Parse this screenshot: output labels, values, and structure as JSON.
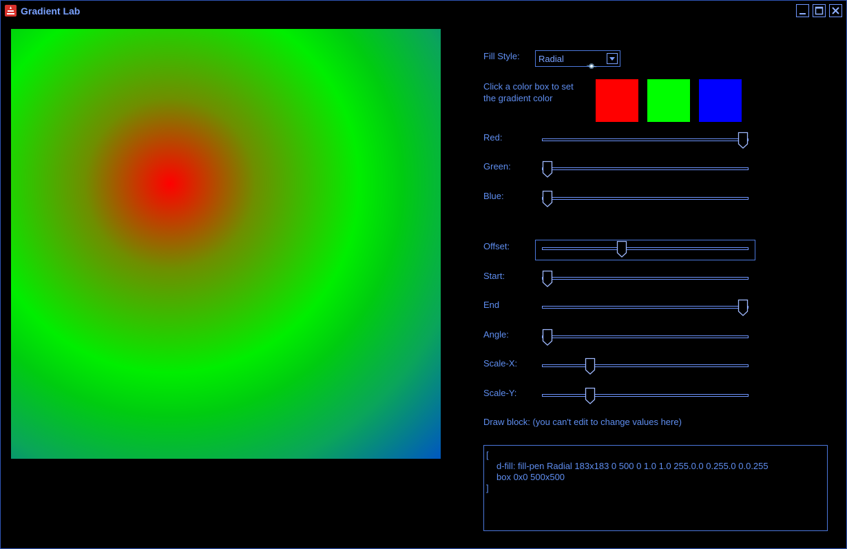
{
  "window": {
    "title": "Gradient Lab",
    "controls": {
      "minimize": "minimize-icon",
      "maximize": "maximize-icon",
      "close": "close-icon"
    }
  },
  "preview": {
    "fill_type": "radial",
    "colors": [
      "#ff0000",
      "#00ff00",
      "#0000ff"
    ]
  },
  "panel": {
    "fill_style_label": "Fill Style:",
    "fill_style_value": "Radial",
    "hint_line1": "Click a color box to set",
    "hint_line2": "the gradient color",
    "swatches": [
      {
        "color": "#ff0000"
      },
      {
        "color": "#00ff00"
      },
      {
        "color": "#0000ff"
      }
    ],
    "sliders": {
      "red": {
        "label": "Red:",
        "value": 1.0
      },
      "green": {
        "label": "Green:",
        "value": 0.0
      },
      "blue": {
        "label": "Blue:",
        "value": 0.0
      },
      "offset": {
        "label": "Offset:",
        "value": 0.38
      },
      "start": {
        "label": "Start:",
        "value": 0.0
      },
      "end": {
        "label": "End",
        "value": 1.0
      },
      "angle": {
        "label": "Angle:",
        "value": 0.0
      },
      "scale_x": {
        "label": "Scale-X:",
        "value": 0.22
      },
      "scale_y": {
        "label": "Scale-Y:",
        "value": 0.22
      }
    },
    "draw_block_label": "Draw block: (you can't edit to change values here)",
    "draw_block": {
      "line1": "[",
      "line2": "d-fill: fill-pen Radial 183x183 0 500 0 1.0 1.0 255.0.0 0.255.0 0.0.255",
      "line3": "box 0x0 500x500",
      "line4": "]"
    }
  }
}
